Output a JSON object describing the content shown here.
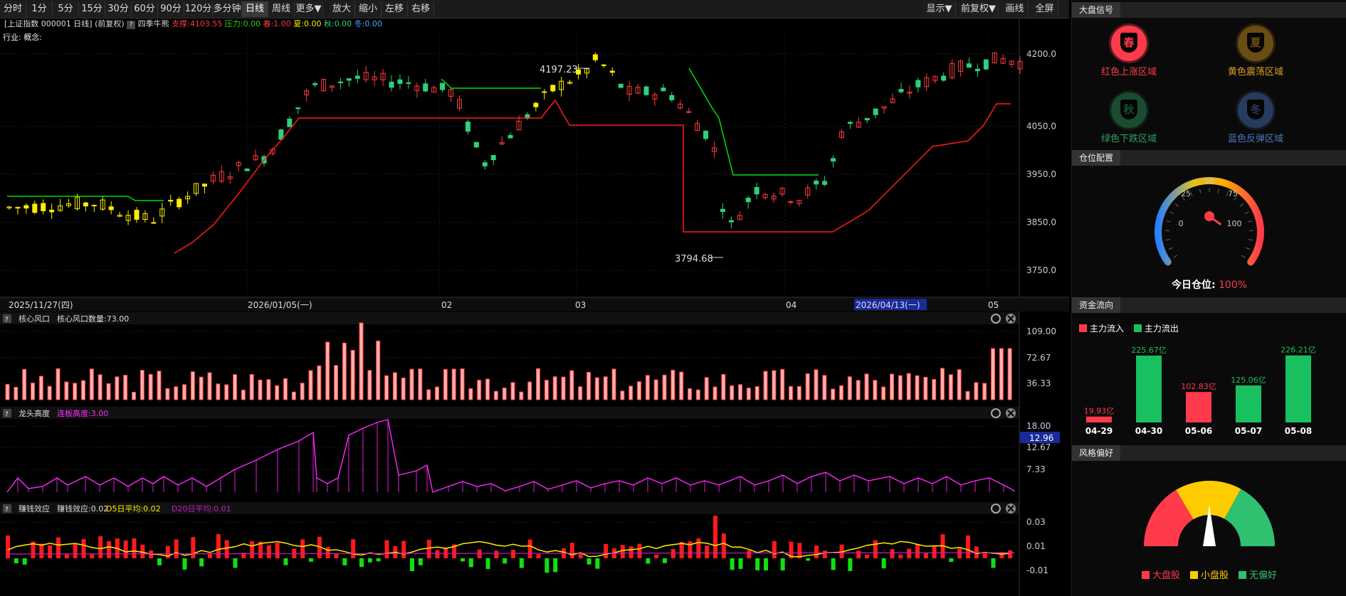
{
  "toolbar": {
    "periods": [
      "分时",
      "1分",
      "5分",
      "15分",
      "30分",
      "60分",
      "90分",
      "120分",
      "多分钟",
      "日线",
      "周线",
      "更多▼",
      "放大",
      "缩小",
      "左移",
      "右移"
    ],
    "active": "日线",
    "right": [
      "显示▼",
      "前复权▼",
      "画线",
      "全屏"
    ]
  },
  "main": {
    "info_prefix": "[上证指数 000001 日线]",
    "info_adjust": "(前复权)",
    "help": "?",
    "indicator_name": "四季牛熊",
    "support": "支撑:4103.55",
    "pressure": "压力:0.00",
    "spring": "春:1.00",
    "summer": "夏:0.00",
    "autumn": "秋:0.00",
    "winter": "冬:0.00",
    "industry": "行业: 概念:",
    "y_ticks": [
      "4200.0",
      "4050.0",
      "3950.0",
      "3850.0",
      "3750.0"
    ],
    "x_labels": [
      "2025/11/27(四)",
      "2026/01/05(一)",
      "02",
      "03",
      "04",
      "2026/04/13(一)",
      "05"
    ],
    "high_label": "4197.23",
    "low_label": "3794.68",
    "colors": {
      "up": "#ff3b3b",
      "down": "#2fd07a",
      "spring_bar": "#ffee00",
      "support_line": "#ff1a1a",
      "pressure_line": "#00e000"
    }
  },
  "sub1": {
    "help": "?",
    "title": "核心风口",
    "value_label": "核心风口数量:73.00",
    "y_ticks": [
      "109.00",
      "72.67",
      "36.33"
    ]
  },
  "sub2": {
    "help": "?",
    "title": "龙头高度",
    "value_label": "连板高度:3.00",
    "y_ticks": [
      "18.00",
      "12.67",
      "7.33"
    ],
    "cursor_value": "12.96"
  },
  "sub3": {
    "help": "?",
    "title": "赚钱效应",
    "value_label": "赚钱效应:0.02",
    "d5": "D5日平均:0.02",
    "d20": "D20日平均:0.01",
    "y_ticks": [
      "0.03",
      "0.01",
      "-0.01"
    ]
  },
  "right": {
    "signal_title": "大盘信号",
    "seasons": [
      {
        "glyph": "春",
        "label": "红色上涨区域",
        "color": "#ff3b4b"
      },
      {
        "glyph": "夏",
        "label": "黄色震荡区域",
        "color": "#e0a020"
      },
      {
        "glyph": "秋",
        "label": "绿色下跌区域",
        "color": "#2fa060"
      },
      {
        "glyph": "冬",
        "label": "蓝色反弹区域",
        "color": "#4a78c0"
      }
    ],
    "position_title": "仓位配置",
    "gauge_ticks": [
      "0",
      "25",
      "50",
      "75",
      "100"
    ],
    "position_label": "今日仓位:",
    "position_value": "100%",
    "position_level": 1.0,
    "flow_title": "资金流向",
    "flow_legend_in": "主力流入",
    "flow_legend_out": "主力流出",
    "flow_data": [
      {
        "date": "04-29",
        "value": 19.93,
        "label": "19.93亿",
        "type": "in"
      },
      {
        "date": "04-30",
        "value": 225.67,
        "label": "225.67亿",
        "type": "out"
      },
      {
        "date": "05-06",
        "value": 102.83,
        "label": "102.83亿",
        "type": "in"
      },
      {
        "date": "05-07",
        "value": 125.06,
        "label": "125.06亿",
        "type": "out"
      },
      {
        "date": "05-08",
        "value": 226.21,
        "label": "226.21亿",
        "type": "out"
      }
    ],
    "style_title": "风格偏好",
    "style_legend": [
      "大盘股",
      "小盘股",
      "无偏好"
    ],
    "style_colors": [
      "#ff3b4b",
      "#ffcc00",
      "#2fc070"
    ]
  }
}
